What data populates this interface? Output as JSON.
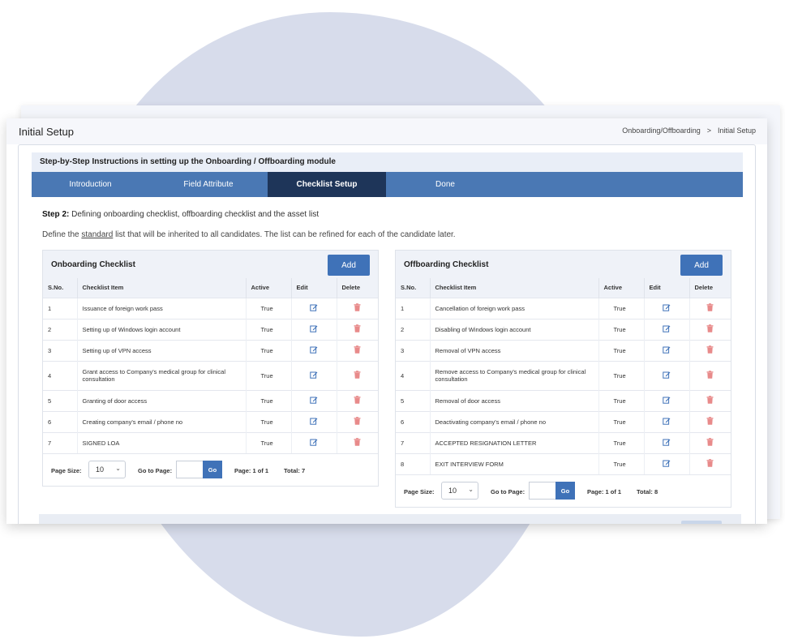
{
  "header": {
    "title": "Initial Setup",
    "breadcrumb": [
      "Onboarding/Offboarding",
      "Initial Setup"
    ],
    "breadcrumb_sep": ">"
  },
  "instructions": {
    "title": "Step-by-Step Instructions in setting up the Onboarding / Offboarding module",
    "tabs": [
      {
        "label": "Introduction",
        "active": false
      },
      {
        "label": "Field Attribute",
        "active": false
      },
      {
        "label": "Checklist Setup",
        "active": true
      },
      {
        "label": "Done",
        "active": false
      }
    ],
    "step_label": "Step 2:",
    "step_text": " Defining onboarding checklist, offboarding checklist and the asset list",
    "define_before": "Define the ",
    "define_link": "standard",
    "define_after": " list that will be inherited to all candidates. The list can be refined for each of the candidate later."
  },
  "columns": {
    "no": "S.No.",
    "item": "Checklist Item",
    "active": "Active",
    "edit": "Edit",
    "delete": "Delete"
  },
  "onboarding": {
    "title": "Onboarding Checklist",
    "add_label": "Add",
    "rows": [
      {
        "no": "1",
        "item": "Issuance of foreign work pass",
        "active": "True"
      },
      {
        "no": "2",
        "item": "Setting up of Windows login account",
        "active": "True"
      },
      {
        "no": "3",
        "item": "Setting up of VPN access",
        "active": "True"
      },
      {
        "no": "4",
        "item": "Grant access to Company's medical group for clinical consultation",
        "active": "True"
      },
      {
        "no": "5",
        "item": "Granting of door access",
        "active": "True"
      },
      {
        "no": "6",
        "item": "Creating company's email / phone no",
        "active": "True"
      },
      {
        "no": "7",
        "item": "SIGNED LOA",
        "active": "True"
      }
    ],
    "pager": {
      "page_size_label": "Page Size:",
      "page_size": "10",
      "goto_label": "Go to Page:",
      "go_label": "Go",
      "page_info": "Page: 1 of 1",
      "total": "Total: 7"
    }
  },
  "offboarding": {
    "title": "Offboarding Checklist",
    "add_label": "Add",
    "rows": [
      {
        "no": "1",
        "item": "Cancellation of foreign work pass",
        "active": "True"
      },
      {
        "no": "2",
        "item": "Disabling of Windows login account",
        "active": "True"
      },
      {
        "no": "3",
        "item": "Removal of VPN access",
        "active": "True"
      },
      {
        "no": "4",
        "item": "Remove access to Company's medical group for clinical consultation",
        "active": "True"
      },
      {
        "no": "5",
        "item": "Removal of door access",
        "active": "True"
      },
      {
        "no": "6",
        "item": "Deactivating company's email / phone no",
        "active": "True"
      },
      {
        "no": "7",
        "item": "ACCEPTED RESIGNATION LETTER",
        "active": "True"
      },
      {
        "no": "8",
        "item": "EXIT INTERVIEW FORM",
        "active": "True"
      }
    ],
    "pager": {
      "page_size_label": "Page Size:",
      "page_size": "10",
      "goto_label": "Go to Page:",
      "go_label": "Go",
      "page_info": "Page: 1 of 1",
      "total": "Total: 8"
    }
  },
  "icons": {
    "edit": "edit-icon",
    "delete": "trash-icon"
  },
  "colors": {
    "accent": "#3f72b8",
    "tab_bar": "#4a78b4",
    "tab_active": "#1e3559",
    "edit_icon": "#3f72b8",
    "delete_icon": "#e88a8a",
    "blob": "#d7dceb"
  }
}
